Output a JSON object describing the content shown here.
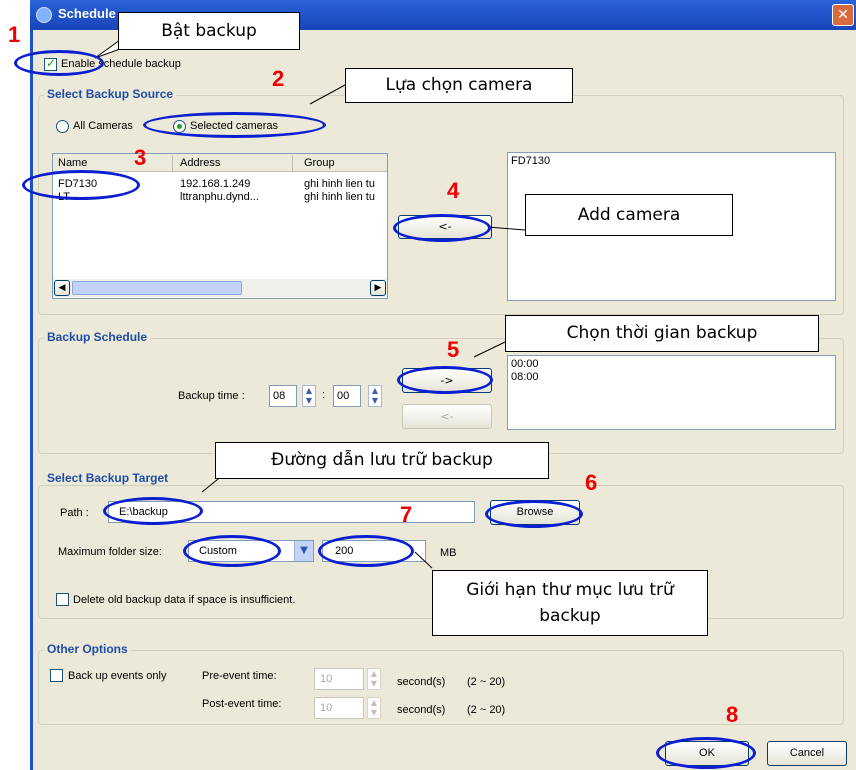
{
  "window": {
    "title": "Schedule"
  },
  "enable_backup": {
    "label": "Enable schedule backup",
    "checked": true
  },
  "source": {
    "title": "Select Backup Source",
    "all_cameras": "All Cameras",
    "selected_cameras": "Selected cameras",
    "columns": [
      "Name",
      "Address",
      "Group"
    ],
    "rows": [
      [
        "FD7130",
        "192.168.1.249",
        "ghi hinh lien tu"
      ],
      [
        "LT",
        "lttranphu.dynd...",
        "ghi hinh lien tu"
      ]
    ],
    "add_button": "<-",
    "selected_list": [
      "FD7130"
    ]
  },
  "schedule": {
    "title": "Backup Schedule",
    "time_label": "Backup time :",
    "hour": "08",
    "colon": ":",
    "minute": "00",
    "add_button": "->",
    "remove_button": "<-",
    "times": [
      "00:00",
      "08:00"
    ]
  },
  "target": {
    "title": "Select Backup Target",
    "path_label": "Path :",
    "path_value": "E:\\backup",
    "browse": "Browse",
    "max_size_label": "Maximum folder size:",
    "max_size_option": "Custom",
    "size_value": "200",
    "unit": "MB",
    "delete_old": "Delete old backup data if space is insufficient."
  },
  "other": {
    "title": "Other Options",
    "events_only": "Back up events only",
    "pre_label": "Pre-event time:",
    "pre_value": "10",
    "post_label": "Post-event time:",
    "post_value": "10",
    "unit": "second(s)",
    "range": "(2 ~ 20)"
  },
  "footer": {
    "ok": "OK",
    "cancel": "Cancel"
  },
  "annotations": {
    "n1": "1",
    "n2": "2",
    "n3": "3",
    "n4": "4",
    "n5": "5",
    "n6": "6",
    "n7": "7",
    "n8": "8",
    "c_enable": "Bật backup",
    "c_camera": "Lựa chọn camera",
    "c_add": "Add camera",
    "c_time": "Chọn thời gian backup",
    "c_path": "Đường dẫn lưu trữ backup",
    "c_limit": "Giới hạn thư mục lưu trữ backup"
  }
}
